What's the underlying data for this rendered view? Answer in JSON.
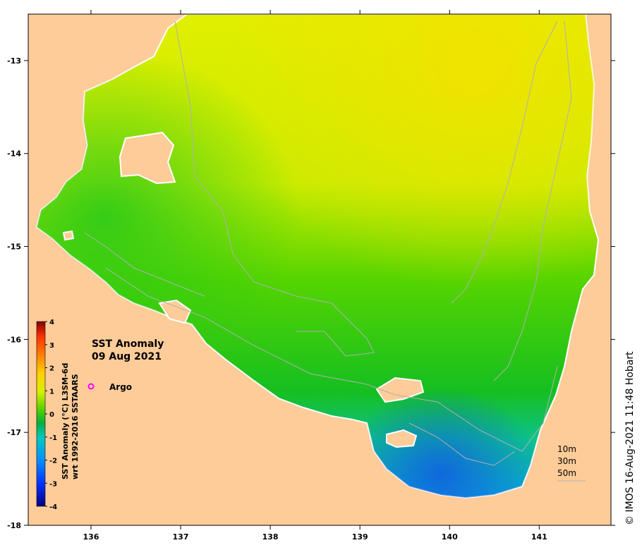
{
  "map": {
    "title_line1": "SST Anomaly",
    "title_line2": "09 Aug 2021",
    "x_ticks": [
      "136",
      "137",
      "138",
      "139",
      "140",
      "141"
    ],
    "y_ticks": [
      "-13",
      "-14",
      "-15",
      "-16",
      "-17",
      "-18"
    ],
    "lon_range": [
      135.3,
      141.8
    ],
    "lat_range": [
      -18.0,
      -12.5
    ],
    "land_color": "#fdcc99",
    "coast_color": "#ffffff"
  },
  "colorbar": {
    "ticks": [
      "4",
      "3",
      "2",
      "1",
      "0",
      "-1",
      "-2",
      "-3",
      "-4"
    ],
    "label_line1": "SST Anomaly (°C) L3SM-6d",
    "label_line2": "wrt 1992-2016 SSTAARS",
    "range": [
      -4,
      4
    ]
  },
  "legend": {
    "marker_label": "Argo",
    "marker_color": "#ff00ff",
    "depth_labels": [
      "10m",
      "30m",
      "50m"
    ]
  },
  "credit": "© IMOS 16-Aug-2021 11:48 Hobart"
}
